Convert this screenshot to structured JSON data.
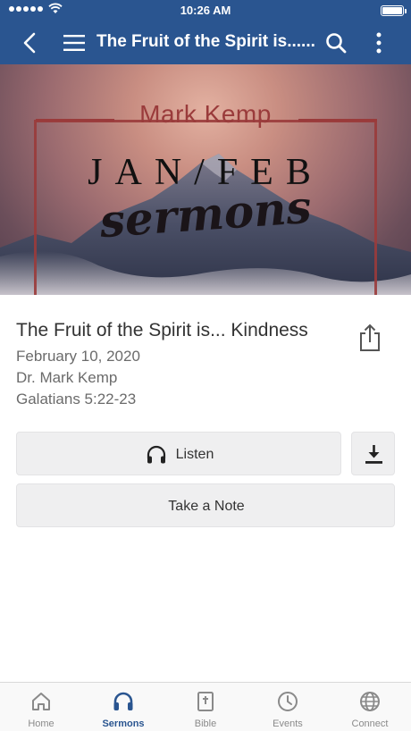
{
  "status_bar": {
    "time": "10:26 AM"
  },
  "nav": {
    "title": "The Fruit of the Spirit is......"
  },
  "hero": {
    "speaker": "Mark Kemp",
    "series": "JAN/FEB",
    "subtitle": "sermons"
  },
  "sermon": {
    "title": "The Fruit of the Spirit is... Kindness",
    "date": "February 10, 2020",
    "speaker": "Dr. Mark Kemp",
    "passage": "Galatians 5:22-23"
  },
  "actions": {
    "listen_label": "Listen",
    "note_label": "Take a Note"
  },
  "tabs": [
    {
      "label": "Home",
      "icon": "home-icon",
      "active": false
    },
    {
      "label": "Sermons",
      "icon": "headphones-icon",
      "active": true
    },
    {
      "label": "Bible",
      "icon": "bible-icon",
      "active": false
    },
    {
      "label": "Events",
      "icon": "clock-icon",
      "active": false
    },
    {
      "label": "Connect",
      "icon": "globe-icon",
      "active": false
    }
  ],
  "colors": {
    "nav": "#2a5590",
    "accent": "#2a5590",
    "frame": "#9a3b3b",
    "inactive_tab": "#8a8a8a"
  }
}
